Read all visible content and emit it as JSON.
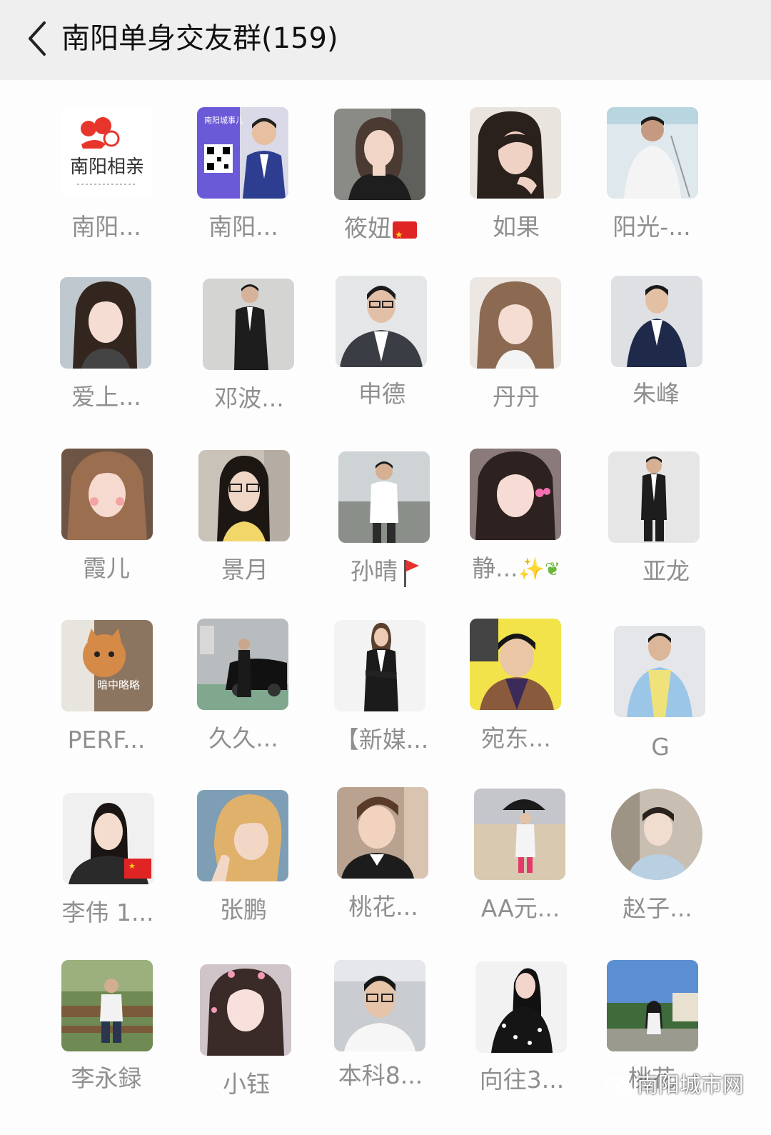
{
  "header": {
    "title": "南阳单身交友群(159)"
  },
  "members": [
    {
      "name": "南阳..."
    },
    {
      "name": "南阳..."
    },
    {
      "name": "筱妞"
    },
    {
      "name": "如果"
    },
    {
      "name": "阳光-..."
    },
    {
      "name": "爱上..."
    },
    {
      "name": "邓波..."
    },
    {
      "name": "申德"
    },
    {
      "name": "丹丹"
    },
    {
      "name": "朱峰"
    },
    {
      "name": "霞儿"
    },
    {
      "name": "景月"
    },
    {
      "name": "孙晴"
    },
    {
      "name": "静..."
    },
    {
      "name": "亚龙"
    },
    {
      "name": "PERF..."
    },
    {
      "name": "久久..."
    },
    {
      "name": "【新媒..."
    },
    {
      "name": "宛东..."
    },
    {
      "name": "G"
    },
    {
      "name": "李伟 1..."
    },
    {
      "name": "张鹏"
    },
    {
      "name": "桃花..."
    },
    {
      "name": "AA元..."
    },
    {
      "name": "赵子..."
    },
    {
      "name": "李永録"
    },
    {
      "name": "小钰"
    },
    {
      "name": "本科8..."
    },
    {
      "name": "向往3..."
    },
    {
      "name": "桃花"
    }
  ],
  "avatar_texts": {
    "logo_line1": "南阳相亲",
    "qr_caption": "南阳城事儿",
    "cat_caption": "暗中略略"
  },
  "watermark": "南阳城市网"
}
